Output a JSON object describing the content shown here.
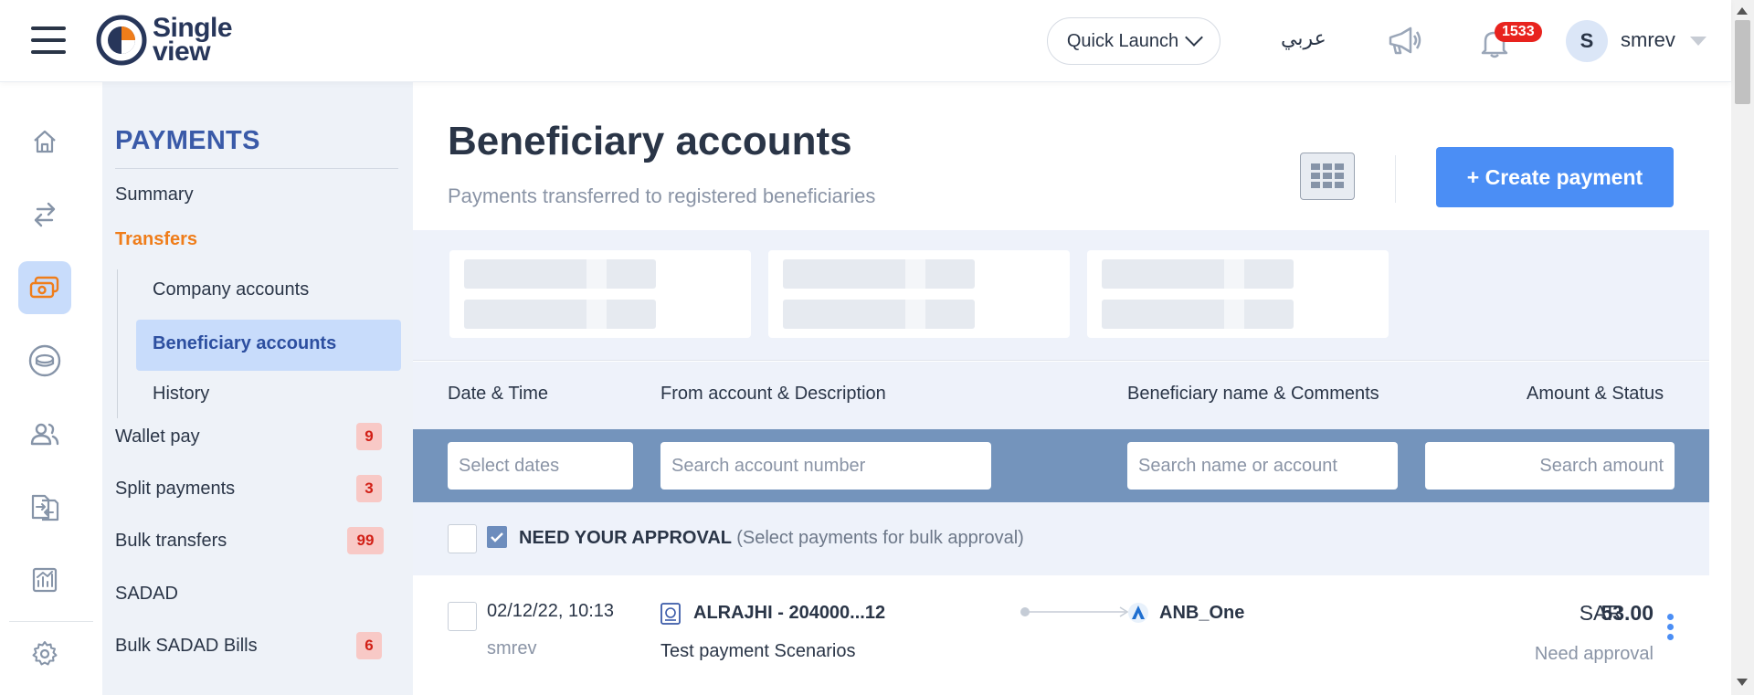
{
  "app": {
    "logo_line1": "Single",
    "logo_line2": "view",
    "quick_launch": "Quick Launch",
    "language": "عربي",
    "notifications_count": "1533",
    "avatar_initial": "S",
    "username": "smrev"
  },
  "sidebar": {
    "section_title": "PAYMENTS",
    "items": [
      {
        "label": "Summary"
      },
      {
        "label": "Transfers"
      },
      {
        "label": "Company accounts"
      },
      {
        "label": "Beneficiary accounts"
      },
      {
        "label": "History"
      },
      {
        "label": "Wallet pay",
        "badge": "9"
      },
      {
        "label": "Split payments",
        "badge": "3"
      },
      {
        "label": "Bulk transfers",
        "badge": "99"
      },
      {
        "label": "SADAD"
      },
      {
        "label": "Bulk SADAD Bills",
        "badge": "6"
      }
    ]
  },
  "page": {
    "title": "Beneficiary accounts",
    "subtitle": "Payments transferred to registered beneficiaries",
    "create_button": "+ Create payment"
  },
  "table": {
    "headers": {
      "date": "Date & Time",
      "from": "From account & Description",
      "beneficiary": "Beneficiary name & Comments",
      "amount": "Amount & Status"
    },
    "filters": {
      "date_placeholder": "Select dates",
      "account_placeholder": "Search account number",
      "name_placeholder": "Search name or account",
      "amount_placeholder": "Search amount"
    },
    "approval": {
      "label": "NEED YOUR APPROVAL",
      "hint": "(Select payments for bulk approval)"
    },
    "rows": [
      {
        "datetime": "02/12/22, 10:13",
        "user": "smrev",
        "from_account": "ALRAJHI - 204000...12",
        "description": "Test payment Scenarios",
        "beneficiary": "ANB_One",
        "currency": "SAR",
        "amount": "53.00",
        "status": "Need approval"
      }
    ]
  },
  "colors": {
    "accent": "#4b8ef5",
    "brand_orange": "#ef7d1a",
    "filter_band": "#7494bc",
    "badge_red": "#e8231e"
  }
}
